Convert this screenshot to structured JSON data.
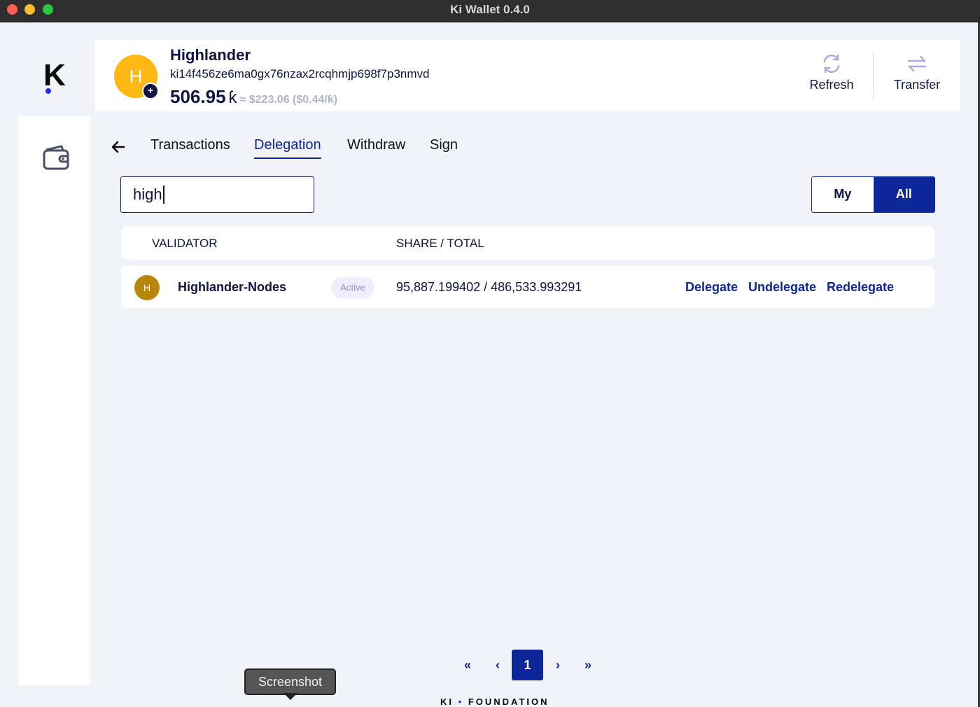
{
  "window": {
    "title": "Ki Wallet 0.4.0"
  },
  "account": {
    "avatar_letter": "H",
    "name": "Highlander",
    "address": "ki14f456ze6ma0gx76nzax2rcqhmjp698f7p3nmvd",
    "balance": "506.95",
    "balance_unit": "ƙ",
    "balance_usd": "≈ $223.06 ($0.44/ƙ)"
  },
  "header_actions": {
    "refresh_label": "Refresh",
    "transfer_label": "Transfer"
  },
  "tabs": [
    {
      "label": "Transactions",
      "active": false
    },
    {
      "label": "Delegation",
      "active": true
    },
    {
      "label": "Withdraw",
      "active": false
    },
    {
      "label": "Sign",
      "active": false
    }
  ],
  "search": {
    "value": "high",
    "placeholder": ""
  },
  "filter_toggle": {
    "my_label": "My",
    "all_label": "All",
    "selected": "All"
  },
  "table": {
    "columns": [
      "VALIDATOR",
      "SHARE / TOTAL"
    ],
    "rows": [
      {
        "avatar_letter": "H",
        "name": "Highlander-Nodes",
        "status": "Active",
        "share_total": "95,887.199402 / 486,533.993291",
        "actions": [
          "Delegate",
          "Undelegate",
          "Redelegate"
        ]
      }
    ]
  },
  "pagination": {
    "first": "«",
    "prev": "‹",
    "current": "1",
    "next": "›",
    "last": "»"
  },
  "tooltip": "Screenshot",
  "footer": {
    "left": "KI",
    "dot": "•",
    "right": "FOUNDATION"
  },
  "colors": {
    "primary": "#0d2699",
    "avatar_account": "#fdb813",
    "avatar_validator": "#b8860b",
    "background": "#f2f3f8"
  },
  "icons": {
    "logo": "ki-logo",
    "sidebar": "wallet-icon",
    "refresh": "refresh-icon",
    "transfer": "transfer-icon",
    "back": "arrow-left-icon"
  }
}
